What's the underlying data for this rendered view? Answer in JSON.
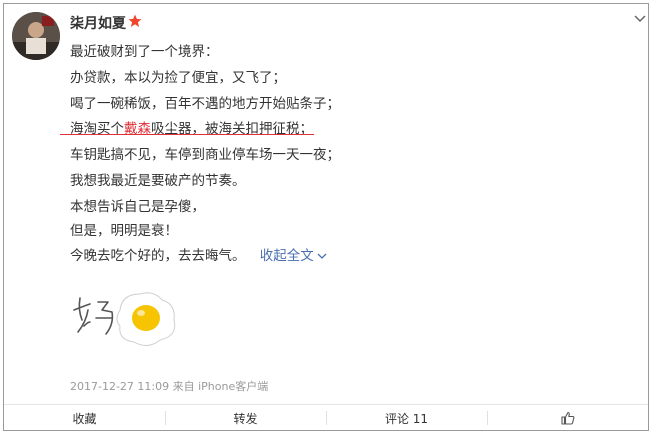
{
  "post": {
    "username": "柒月如夏",
    "lines": [
      "最近破财到了一个境界：",
      "办贷款，本以为捡了便宜，又飞了；",
      "喝了一碗稀饭，百年不遇的地方开始贴条子；",
      "海淘买个",
      "戴森",
      "吸尘器，被海关扣押征税；",
      "车钥匙搞不见，车停到商业停车场一天一夜；",
      "我想我最近是要破产的节奏。",
      "本想告诉自己是孕傻，",
      "但是，明明是衰！",
      "今晚去吃个好的，去去晦气。"
    ],
    "collapse_label": "收起全文",
    "timestamp": "2017-12-27 11:09 来自 iPhone客户端"
  },
  "actions": {
    "favorite": "收藏",
    "repost": "转发",
    "comment": "评论 11"
  },
  "colors": {
    "accent_red": "#e0303a",
    "link_blue": "#4a6fb0"
  }
}
